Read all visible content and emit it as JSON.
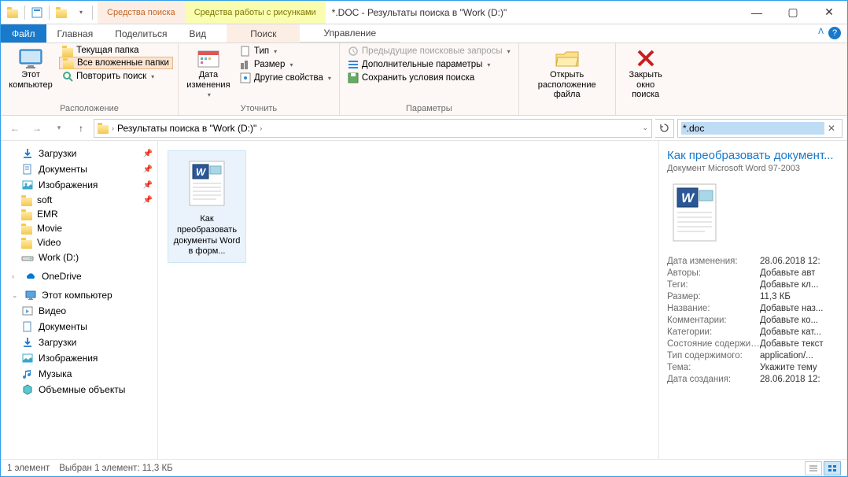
{
  "titlebar": {
    "ctx_search": "Средства поиска",
    "ctx_picture": "Средства работы с рисунками",
    "title": "*.DOC - Результаты поиска в \"Work (D:)\""
  },
  "tabs": {
    "file": "Файл",
    "home": "Главная",
    "share": "Поделиться",
    "view": "Вид",
    "search": "Поиск",
    "manage": "Управление"
  },
  "ribbon": {
    "this_pc": "Этот\nкомпьютер",
    "current_folder": "Текущая папка",
    "all_subfolders": "Все вложенные папки",
    "repeat_search": "Повторить поиск",
    "group_location": "Расположение",
    "date_modified": "Дата\nизменения",
    "type": "Тип",
    "size": "Размер",
    "other_props": "Другие свойства",
    "group_refine": "Уточнить",
    "prev_searches": "Предыдущие поисковые запросы",
    "advanced": "Дополнительные параметры",
    "save_search": "Сохранить условия поиска",
    "group_params": "Параметры",
    "open_location": "Открыть\nрасположение файла",
    "close_search": "Закрыть\nокно поиска"
  },
  "nav": {
    "breadcrumb": "Результаты поиска в \"Work (D:)\"",
    "search_value": "*.doc"
  },
  "tree": {
    "downloads": "Загрузки",
    "documents": "Документы",
    "pictures": "Изображения",
    "soft": "soft",
    "emr": "EMR",
    "movie": "Movie",
    "video": "Video",
    "work": "Work (D:)",
    "onedrive": "OneDrive",
    "this_pc": "Этот компьютер",
    "videos2": "Видео",
    "documents2": "Документы",
    "downloads2": "Загрузки",
    "pictures2": "Изображения",
    "music": "Музыка",
    "objects3d": "Объемные объекты"
  },
  "file": {
    "name": "Как преобразовать документы Word в форм..."
  },
  "details": {
    "title": "Как преобразовать документ...",
    "subtitle": "Документ Microsoft Word 97-2003",
    "props": [
      {
        "label": "Дата изменения:",
        "value": "28.06.2018 12:"
      },
      {
        "label": "Авторы:",
        "value": "Добавьте авт"
      },
      {
        "label": "Теги:",
        "value": "Добавьте кл..."
      },
      {
        "label": "Размер:",
        "value": "11,3 КБ"
      },
      {
        "label": "Название:",
        "value": "Добавьте наз..."
      },
      {
        "label": "Комментарии:",
        "value": "Добавьте ко..."
      },
      {
        "label": "Категории:",
        "value": "Добавьте кат..."
      },
      {
        "label": "Состояние содержим...",
        "value": "Добавьте текст"
      },
      {
        "label": "Тип содержимого:",
        "value": "application/..."
      },
      {
        "label": "Тема:",
        "value": "Укажите тему"
      },
      {
        "label": "Дата создания:",
        "value": "28.06.2018 12:"
      }
    ]
  },
  "status": {
    "count": "1 элемент",
    "selected": "Выбран 1 элемент: 11,3 КБ"
  }
}
